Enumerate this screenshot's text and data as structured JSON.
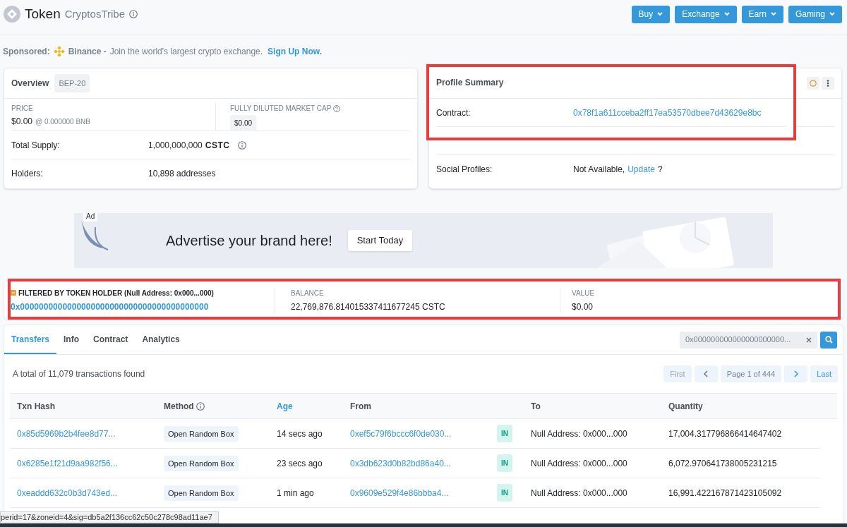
{
  "header": {
    "title": "Token",
    "subtitle": "CryptosTribe"
  },
  "nav_buttons": [
    "Buy",
    "Exchange",
    "Earn",
    "Gaming"
  ],
  "sponsored": {
    "label": "Sponsored:",
    "brand": "Binance -",
    "text": "Join the world's largest crypto exchange.",
    "link": "Sign Up Now."
  },
  "overview": {
    "title": "Overview",
    "badge": "BEP-20",
    "price_label": "PRICE",
    "price": "$0.00",
    "price_bnb": "@ 0.000000 BNB",
    "mcap_label": "FULLY DILUTED MARKET CAP",
    "mcap": "$0.00",
    "supply_label": "Total Supply:",
    "supply": "1,000,000,000",
    "supply_unit": "CSTC",
    "holders_label": "Holders:",
    "holders": "10,898 addresses"
  },
  "profile": {
    "title": "Profile Summary",
    "highlighted": true,
    "contract_label": "Contract:",
    "contract": "0x78f1a611cceba2ff17ea53570dbee7d43629e8bc",
    "social_label": "Social Profiles:",
    "social_value": "Not Available,",
    "social_link": "Update",
    "social_suffix": "?"
  },
  "ad": {
    "badge": "Ad",
    "headline": "Advertise your brand here!",
    "button": "Start Today"
  },
  "filter": {
    "highlighted": true,
    "title": "FILTERED BY TOKEN HOLDER (Null Address: 0x000...000)",
    "address": "0x0000000000000000000000000000000000000000",
    "balance_label": "BALANCE",
    "balance": "22,769,876.814015337411677245 CSTC",
    "value_label": "VALUE",
    "value": "$0.00"
  },
  "tabs": [
    {
      "label": "Transfers",
      "selected": true
    },
    {
      "label": "Info",
      "selected": false
    },
    {
      "label": "Contract",
      "selected": false
    },
    {
      "label": "Analytics",
      "selected": false
    }
  ],
  "search": {
    "value": "0x000000000000000000000..."
  },
  "summary": "A total of 11,079 transactions found",
  "pagination": {
    "first": "First",
    "page": "Page 1 of 444",
    "last": "Last"
  },
  "table": {
    "columns": [
      {
        "label": "Txn Hash",
        "selected": false
      },
      {
        "label": "Method",
        "selected": false
      },
      {
        "label": "Age",
        "selected": true
      },
      {
        "label": "From",
        "selected": false
      },
      {
        "label": "To",
        "selected": false
      },
      {
        "label": "Quantity",
        "selected": false
      }
    ],
    "rows": [
      {
        "hash": "0x85d5969b2b4fee8d77...",
        "method": "Open Random Box",
        "age": "14 secs ago",
        "from": "0xef5c79f6bccc6f0de030...",
        "direction": "IN",
        "to": "Null Address: 0x000...000",
        "quantity": "17,004.317796866414647402"
      },
      {
        "hash": "0x6285e1f21d9aa982f56...",
        "method": "Open Random Box",
        "age": "23 secs ago",
        "from": "0x3db623d0b82bd86a40...",
        "direction": "IN",
        "to": "Null Address: 0x000...000",
        "quantity": "6,072.970641738005231215"
      },
      {
        "hash": "0xeaddd632c0b3d743ed...",
        "method": "Open Random Box",
        "age": "1 min ago",
        "from": "0x9609e529f4e86bbba4...",
        "direction": "IN",
        "to": "Null Address: 0x000...000",
        "quantity": "16,991.422167871423105092"
      }
    ]
  },
  "status_url": "perid=17&zoneid=4&sig=db5a2f136cc62c50c278c98ad11ae7"
}
